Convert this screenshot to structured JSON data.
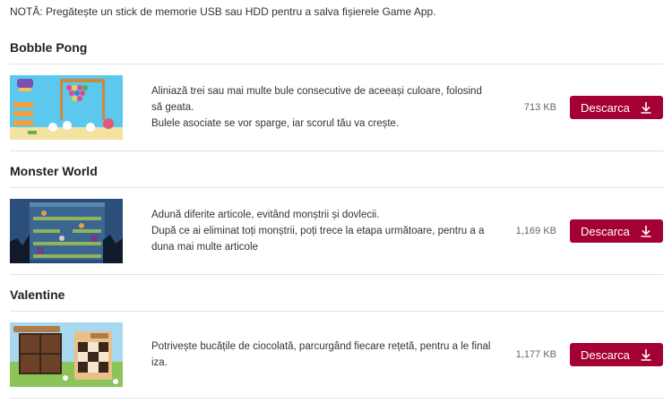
{
  "note": "NOTĂ: Pregătește un stick de memorie USB sau HDD pentru a salva fișierele Game App.",
  "games": [
    {
      "title": "Bobble Pong",
      "description_lines": [
        "Aliniază trei sau mai multe bule consecutive de aceeași culoare, folosind să geata.",
        "Bulele asociate se vor sparge, iar scorul tău va crește."
      ],
      "size": "713 KB",
      "button_label": "Descarca",
      "thumbnail_icon": "bobble-pong-thumbnail"
    },
    {
      "title": "Monster World",
      "description_lines": [
        "Adună diferite articole, evitând monștrii și dovlecii.",
        "După ce ai eliminat toți monștrii, poți trece la etapa următoare, pentru a a duna mai multe articole"
      ],
      "size": "1,169 KB",
      "button_label": "Descarca",
      "thumbnail_icon": "monster-world-thumbnail"
    },
    {
      "title": "Valentine",
      "description_lines": [
        "Potrivește bucățile de ciocolată, parcurgând fiecare rețetă, pentru a le final iza."
      ],
      "size": "1,177 KB",
      "button_label": "Descarca",
      "thumbnail_icon": "valentine-thumbnail"
    }
  ],
  "colors": {
    "button_bg": "#a50034",
    "divider": "#e2e2e2"
  }
}
